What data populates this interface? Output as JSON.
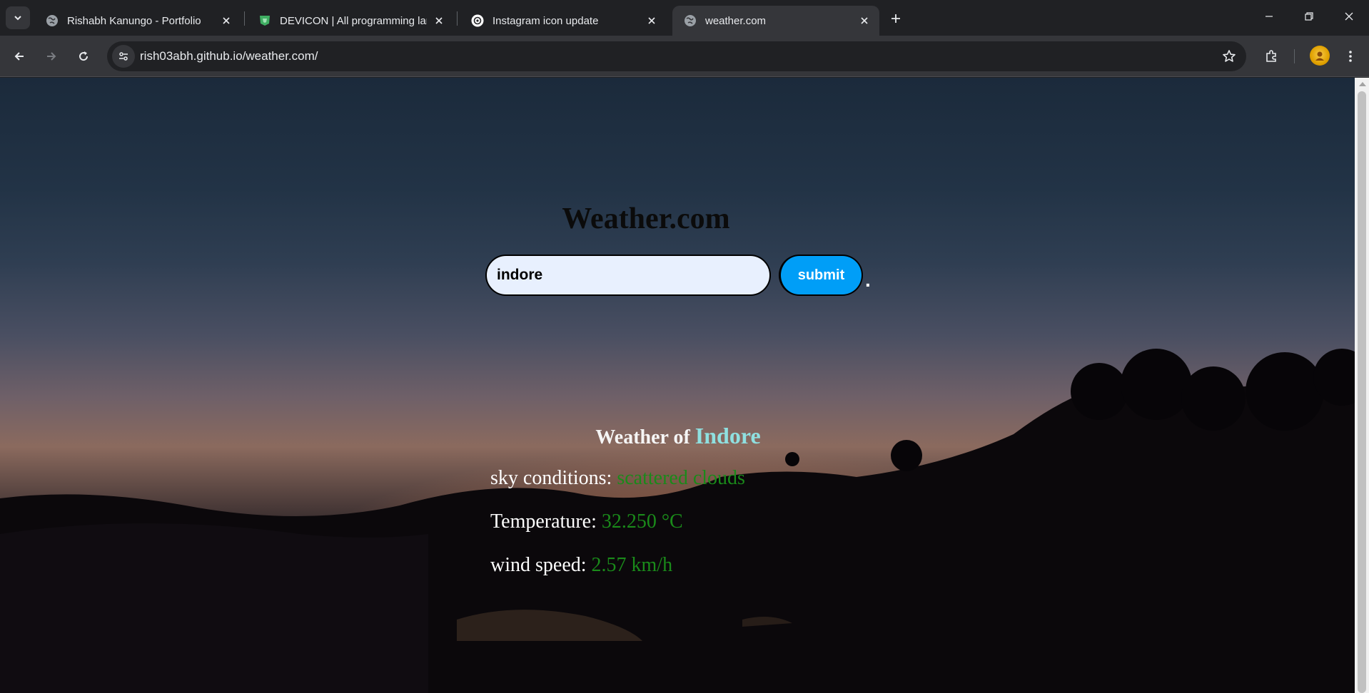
{
  "browser": {
    "tabs": [
      {
        "title": "Rishabh Kanungo - Portfolio",
        "favicon": "globe-icon",
        "active": false
      },
      {
        "title": "DEVICON | All programming lan",
        "favicon": "devicon-shield-icon",
        "active": false
      },
      {
        "title": "Instagram icon update",
        "favicon": "openai-icon",
        "active": false
      },
      {
        "title": "weather.com",
        "favicon": "globe-icon",
        "active": true
      }
    ],
    "address": "rish03abh.github.io/weather.com/"
  },
  "page": {
    "heading": "Weather.com",
    "search": {
      "value": "indore"
    },
    "submit_label": "submit",
    "trailing_dot": ".",
    "result": {
      "prefix": "Weather of",
      "city": "Indore",
      "rows": [
        {
          "label": "sky conditions:",
          "value": "scattered clouds"
        },
        {
          "label": "Temperature:",
          "value": "32.250 °C"
        },
        {
          "label": "wind speed:",
          "value": "2.57 km/h"
        }
      ]
    }
  },
  "colors": {
    "submit_bg": "#009ef7",
    "city": "#8fe0e0",
    "value_text": "#1a8a1a",
    "input_bg": "#e8f0fe"
  }
}
